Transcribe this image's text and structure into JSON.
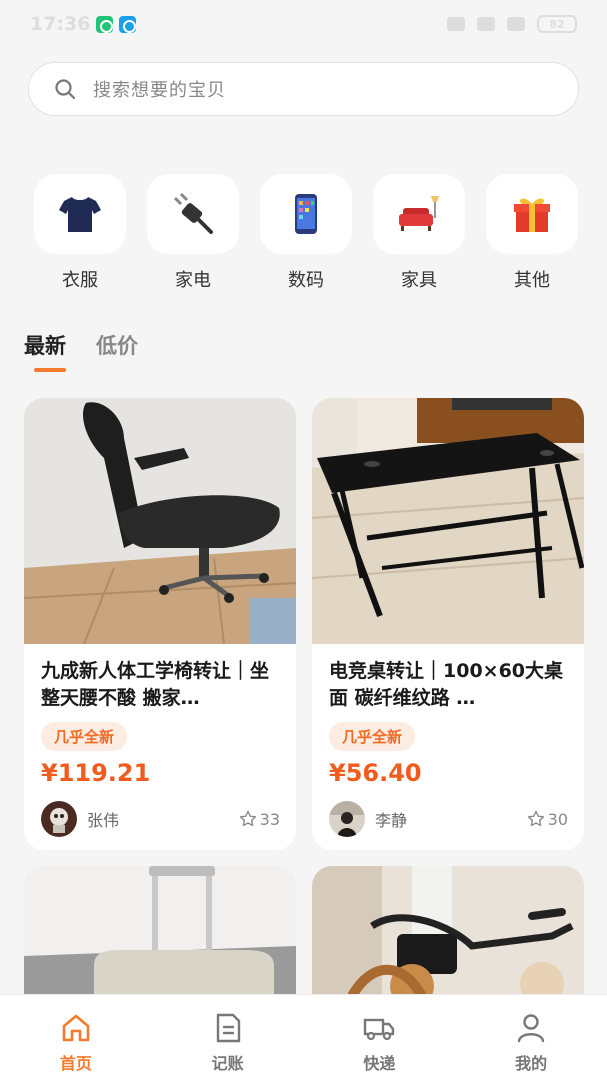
{
  "status_bar": {
    "time": "17:36",
    "battery": "82"
  },
  "search": {
    "placeholder": "搜索想要的宝贝"
  },
  "categories": [
    {
      "label": "衣服",
      "icon": "tshirt-icon"
    },
    {
      "label": "家电",
      "icon": "plug-icon"
    },
    {
      "label": "数码",
      "icon": "phone-icon"
    },
    {
      "label": "家具",
      "icon": "sofa-icon"
    },
    {
      "label": "其他",
      "icon": "gift-icon"
    }
  ],
  "tabs": [
    {
      "label": "最新",
      "active": true
    },
    {
      "label": "低价",
      "active": false
    }
  ],
  "listings": [
    {
      "title": "九成新人体工学椅转让｜坐整天腰不酸 搬家…",
      "badge": "几乎全新",
      "price": "¥119.21",
      "seller": "张伟",
      "likes": "33"
    },
    {
      "title": "电竞桌转让｜100×60大桌面 碳纤维纹路 …",
      "badge": "几乎全新",
      "price": "¥56.40",
      "seller": "李静",
      "likes": "30"
    }
  ],
  "bottom_nav": [
    {
      "label": "首页",
      "icon": "home-icon",
      "active": true
    },
    {
      "label": "记账",
      "icon": "ledger-icon",
      "active": false
    },
    {
      "label": "快递",
      "icon": "truck-icon",
      "active": false
    },
    {
      "label": "我的",
      "icon": "user-icon",
      "active": false
    }
  ],
  "colors": {
    "accent": "#f47a2d",
    "price": "#f05c1e",
    "badge_bg": "#fdece2"
  }
}
